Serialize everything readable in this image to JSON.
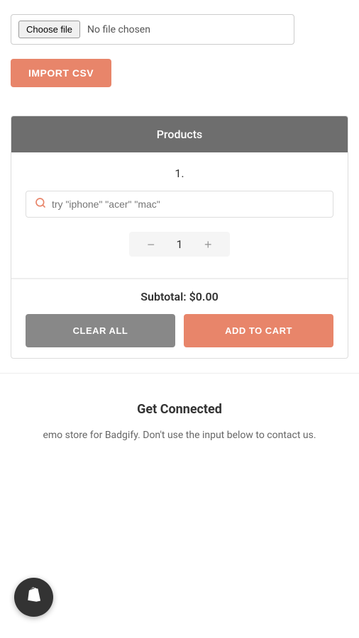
{
  "file_input": {
    "choose_file_label": "Choose file",
    "no_file_text": "No file chosen"
  },
  "import_button": {
    "label": "IMPORT CSV"
  },
  "products_section": {
    "header": "Products",
    "product_number": "1.",
    "search_placeholder": "try \"iphone\" \"acer\" \"mac\"",
    "quantity": "1"
  },
  "subtotal": {
    "label": "Subtotal: $0.00"
  },
  "buttons": {
    "clear_all": "CLEAR ALL",
    "add_to_cart": "ADD TO CART"
  },
  "get_connected": {
    "title": "Get Connected",
    "description": "emo store for Badgify. Don't use the input below to contact us."
  },
  "shopify": {
    "icon": "S"
  }
}
